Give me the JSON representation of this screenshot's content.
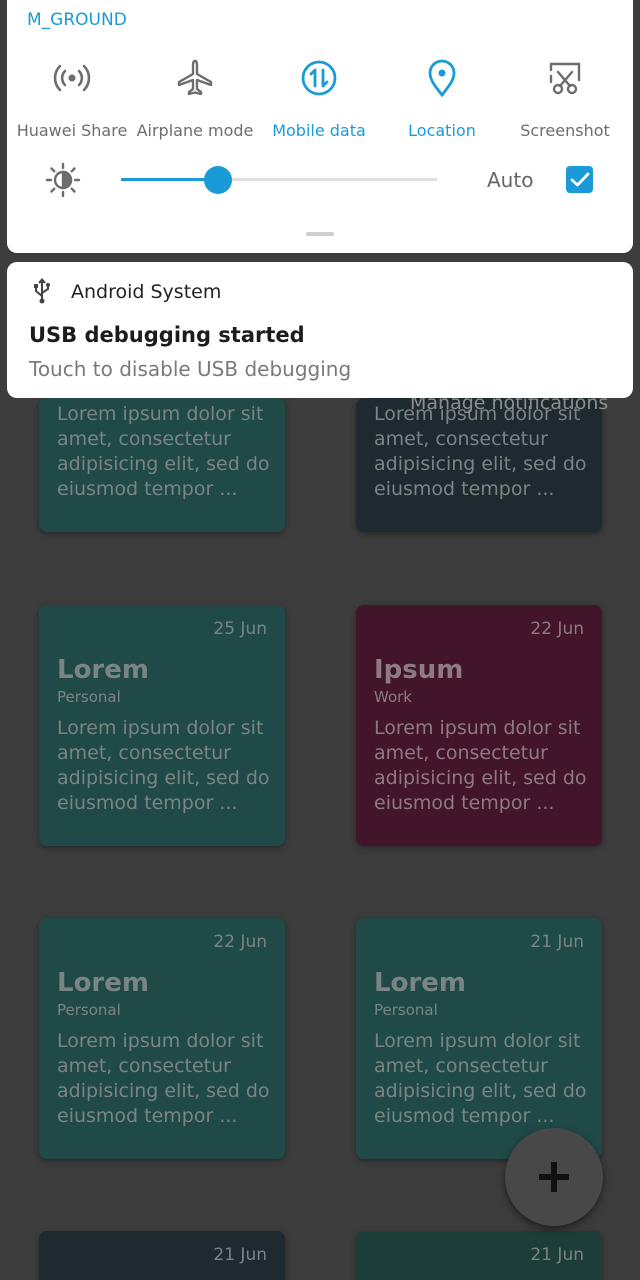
{
  "quick_settings": {
    "top_row_labels": [
      "M_GROUND"
    ],
    "tiles": [
      {
        "label": "Huawei Share",
        "icon": "huawei-share-icon",
        "active": false
      },
      {
        "label": "Airplane mode",
        "icon": "airplane-icon",
        "active": false
      },
      {
        "label": "Mobile data",
        "icon": "mobile-data-icon",
        "active": true
      },
      {
        "label": "Location",
        "icon": "location-icon",
        "active": true
      },
      {
        "label": "Screenshot",
        "icon": "screenshot-icon",
        "active": false
      }
    ],
    "brightness": {
      "level": 0.31,
      "auto_label": "Auto",
      "auto_checked": true
    }
  },
  "notification": {
    "app_name": "Android System",
    "title": "USB debugging started",
    "text": "Touch to disable USB debugging"
  },
  "manage_notifications": "Manage notifications",
  "cards": [
    {
      "date": "",
      "title": "",
      "category": "",
      "body": "Lorem ipsum dolor sit amet, consectetur adipisicing elit, sed do eiusmod tempor ...",
      "color": "#1f4a48"
    },
    {
      "date": "",
      "title": "",
      "category": "",
      "body": "Lorem ipsum dolor sit amet, consectetur adipisicing elit, sed do eiusmod tempor ...",
      "color": "#1e2a30"
    },
    {
      "date": "25 Jun",
      "title": "Lorem",
      "category": "Personal",
      "body": "Lorem ipsum dolor sit amet, consectetur adipisicing elit, sed do eiusmod tempor ...",
      "color": "#1f4a48"
    },
    {
      "date": "22 Jun",
      "title": "Ipsum",
      "category": "Work",
      "body": "Lorem ipsum dolor sit amet, consectetur adipisicing elit, sed do eiusmod tempor ...",
      "color": "#43152a"
    },
    {
      "date": "22 Jun",
      "title": "Lorem",
      "category": "Personal",
      "body": "Lorem ipsum dolor sit amet, consectetur adipisicing elit, sed do eiusmod tempor ...",
      "color": "#1f4a48"
    },
    {
      "date": "21 Jun",
      "title": "Lorem",
      "category": "Personal",
      "body": "Lorem ipsum dolor sit amet, consectetur adipisicing elit, sed do eiusmod tempor ...",
      "color": "#1f4a48"
    },
    {
      "date": "21 Jun",
      "title": "",
      "category": "",
      "body": "",
      "color": "#1e2a30"
    },
    {
      "date": "21 Jun",
      "title": "",
      "category": "",
      "body": "",
      "color": "#1f4a48"
    }
  ],
  "fab": {
    "label": "+",
    "icon": "plus-icon"
  },
  "colors": {
    "accent": "#1a9bd7",
    "scrim": "#3c3c3c"
  }
}
